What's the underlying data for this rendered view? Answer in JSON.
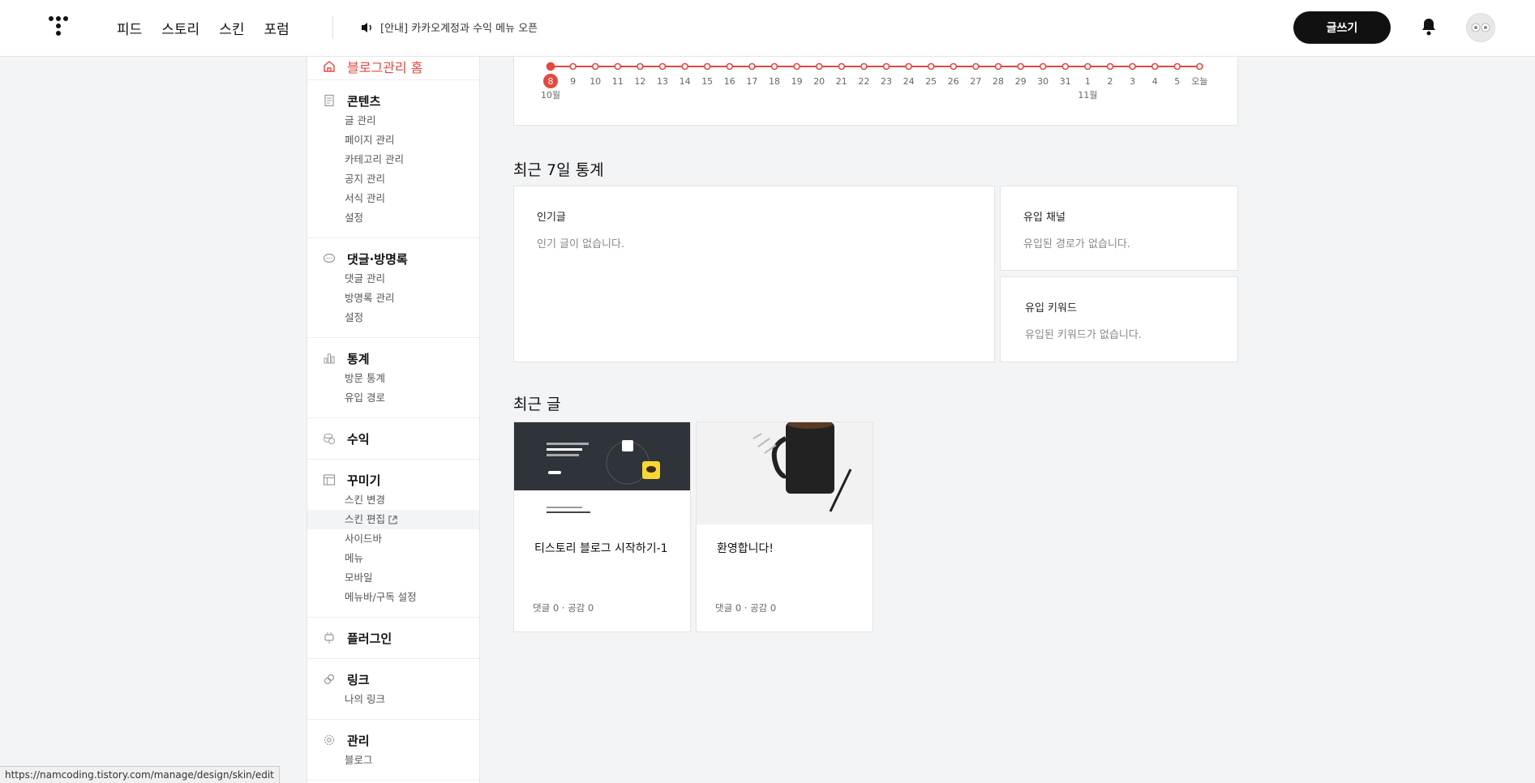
{
  "topbar": {
    "nav": [
      "피드",
      "스토리",
      "스킨",
      "포럼"
    ],
    "notice": "[안내] 카카오계정과 수익 메뉴 오픈",
    "write_label": "글쓰기"
  },
  "sidebar": {
    "home": "블로그관리 홈",
    "sections": [
      {
        "title": "콘텐츠",
        "icon": "document-icon",
        "items": [
          "글 관리",
          "페이지 관리",
          "카테고리 관리",
          "공지 관리",
          "서식 관리",
          "설정"
        ]
      },
      {
        "title": "댓글·방명록",
        "icon": "comment-icon",
        "items": [
          "댓글 관리",
          "방명록 관리",
          "설정"
        ]
      },
      {
        "title": "통계",
        "icon": "bar-chart-icon",
        "items": [
          "방문 통계",
          "유입 경로"
        ]
      },
      {
        "title": "수익",
        "icon": "coins-icon",
        "items": []
      },
      {
        "title": "꾸미기",
        "icon": "layout-icon",
        "items": [
          "스킨 변경",
          "스킨 편집",
          "사이드바",
          "메뉴",
          "모바일",
          "메뉴바/구독 설정"
        ]
      },
      {
        "title": "플러그인",
        "icon": "plug-icon",
        "items": []
      },
      {
        "title": "링크",
        "icon": "link-icon",
        "items": [
          "나의 링크"
        ]
      },
      {
        "title": "관리",
        "icon": "gear-icon",
        "items": [
          "블로그"
        ]
      }
    ]
  },
  "chart_data": {
    "type": "line",
    "x": [
      "8",
      "9",
      "10",
      "11",
      "12",
      "13",
      "14",
      "15",
      "16",
      "17",
      "18",
      "19",
      "20",
      "21",
      "22",
      "23",
      "24",
      "25",
      "26",
      "27",
      "28",
      "29",
      "30",
      "31",
      "1",
      "2",
      "3",
      "4",
      "5",
      "오늘"
    ],
    "month_labels": [
      {
        "label": "10월",
        "at": "8"
      },
      {
        "label": "11월",
        "at": "1"
      }
    ],
    "values": [
      0,
      0,
      0,
      0,
      0,
      0,
      0,
      0,
      0,
      0,
      0,
      0,
      0,
      0,
      0,
      0,
      0,
      0,
      0,
      0,
      0,
      0,
      0,
      0,
      0,
      0,
      0,
      0,
      0,
      0
    ],
    "highlighted": "8",
    "color": "#e5483d"
  },
  "stats": {
    "title": "최근 7일 통계",
    "popular": {
      "title": "인기글",
      "empty": "인기 글이 없습니다."
    },
    "channel": {
      "title": "유입 채널",
      "empty": "유입된 경로가 없습니다."
    },
    "keyword": {
      "title": "유입 키워드",
      "empty": "유입된 키워드가 없습니다."
    }
  },
  "recent": {
    "title": "최근 글",
    "posts": [
      {
        "title": "티스토리 블로그 시작하기-1",
        "meta": "댓글 0 · 공감 0"
      },
      {
        "title": "환영합니다!",
        "meta": "댓글 0 · 공감 0"
      }
    ]
  },
  "statusbar": "https://namcoding.tistory.com/manage/design/skin/edit"
}
